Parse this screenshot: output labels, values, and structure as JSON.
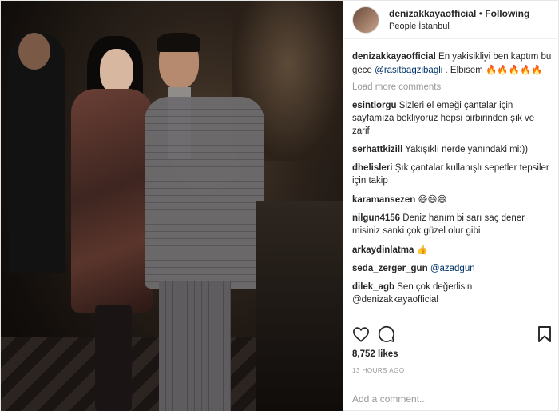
{
  "header": {
    "username": "denizakkayaofficial",
    "separator": "•",
    "follow_label": "Following",
    "location": "People İstanbul"
  },
  "caption": {
    "username": "denizakkayaofficial",
    "text_part1": "En yakisikliyi ben kaptım bu gece",
    "mention": "@rasitbagzibagli",
    "text_part2": ". Elbisem",
    "emoji": "🔥🔥🔥🔥🔥"
  },
  "load_more_label": "Load more comments",
  "comments": [
    {
      "username": "esintiorgu",
      "text": "Sizleri el emeği çantalar için sayfamıza bekliyoruz hepsi birbirinden şık ve zarif"
    },
    {
      "username": "serhattkizill",
      "text": "Yakışıklı nerde yanındaki mi:))"
    },
    {
      "username": "dhelisleri",
      "text": "Şık çantalar kullanışlı sepetler tepsiler için takip"
    },
    {
      "username": "karamansezen",
      "text": "😄😄😄"
    },
    {
      "username": "nilgun4156",
      "text": "Deniz hanım bi sarı saç dener misiniz sanki çok güzel olur gibi"
    },
    {
      "username": "arkaydinlatma",
      "text": "👍"
    },
    {
      "username": "seda_zerger_gun",
      "text": "@azadgun"
    },
    {
      "username": "dilek_agb",
      "text": "Sen çok değerlisin @denizakkayaofficial"
    }
  ],
  "actions": {
    "like_icon": "heart-outline-icon",
    "comment_icon": "speech-bubble-icon",
    "bookmark_icon": "bookmark-outline-icon"
  },
  "likes": "8,752 likes",
  "timestamp": "13 HOURS AGO",
  "add_comment_placeholder": "Add a comment..."
}
